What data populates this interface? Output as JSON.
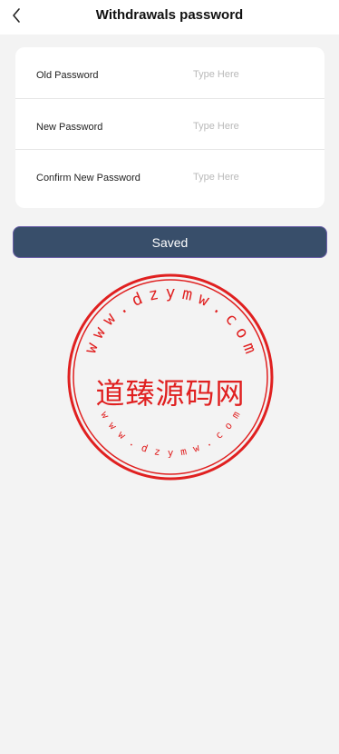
{
  "header": {
    "title": "Withdrawals password",
    "back_icon": "chevron-left-icon"
  },
  "form": {
    "fields": [
      {
        "label": "Old Password",
        "placeholder": "Type Here",
        "value": ""
      },
      {
        "label": "New Password",
        "placeholder": "Type Here",
        "value": ""
      },
      {
        "label": "Confirm New Password",
        "placeholder": "Type Here",
        "value": ""
      }
    ]
  },
  "save_button": {
    "label": "Saved",
    "color": "#384e6a"
  },
  "watermark": {
    "outer_text": "www.dzymw.com",
    "inner_text": "www.dzymw.com",
    "center_text": "道臻源码网",
    "color": "#e02020"
  }
}
